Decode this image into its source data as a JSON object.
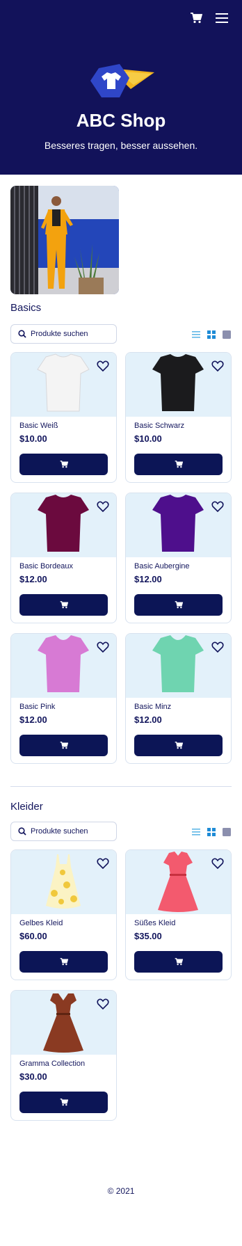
{
  "header": {
    "shop_name": "ABC Shop",
    "tagline": "Besseres tragen, besser aussehen.",
    "cart_icon": "cart-icon",
    "menu_icon": "hamburger-menu-icon"
  },
  "colors": {
    "primary_dark": "#12125a",
    "button": "#0c1556",
    "thumb_bg": "#e3f1fa",
    "accent_yellow": "#f3b51f",
    "accent_blue": "#2f46c8"
  },
  "categories": [
    {
      "title": "Basics",
      "search_placeholder": "Produkte suchen",
      "view_toggle_icons": [
        "list-view-icon",
        "grid-view-icon",
        "large-view-icon"
      ],
      "products": [
        {
          "name": "Basic Weiß",
          "price": "$10.00",
          "color": "#f4f4f4"
        },
        {
          "name": "Basic Schwarz",
          "price": "$10.00",
          "color": "#1b1b1d"
        },
        {
          "name": "Basic Bordeaux",
          "price": "$12.00",
          "color": "#6b0a3e"
        },
        {
          "name": "Basic Aubergine",
          "price": "$12.00",
          "color": "#4e0f8c"
        },
        {
          "name": "Basic Pink",
          "price": "$12.00",
          "color": "#d77ad4"
        },
        {
          "name": "Basic Minz",
          "price": "$12.00",
          "color": "#6fd4b0"
        }
      ]
    },
    {
      "title": "Kleider",
      "search_placeholder": "Produkte suchen",
      "view_toggle_icons": [
        "list-view-icon",
        "grid-view-icon",
        "large-view-icon"
      ],
      "products": [
        {
          "name": "Gelbes Kleid",
          "price": "$60.00",
          "color": "#f0d548"
        },
        {
          "name": "Süßes Kleid",
          "price": "$35.00",
          "color": "#f35a6e"
        },
        {
          "name": "Gramma Collection",
          "price": "$30.00",
          "color": "#8a3a22"
        }
      ]
    }
  ],
  "footer": {
    "copyright": "© 2021"
  }
}
